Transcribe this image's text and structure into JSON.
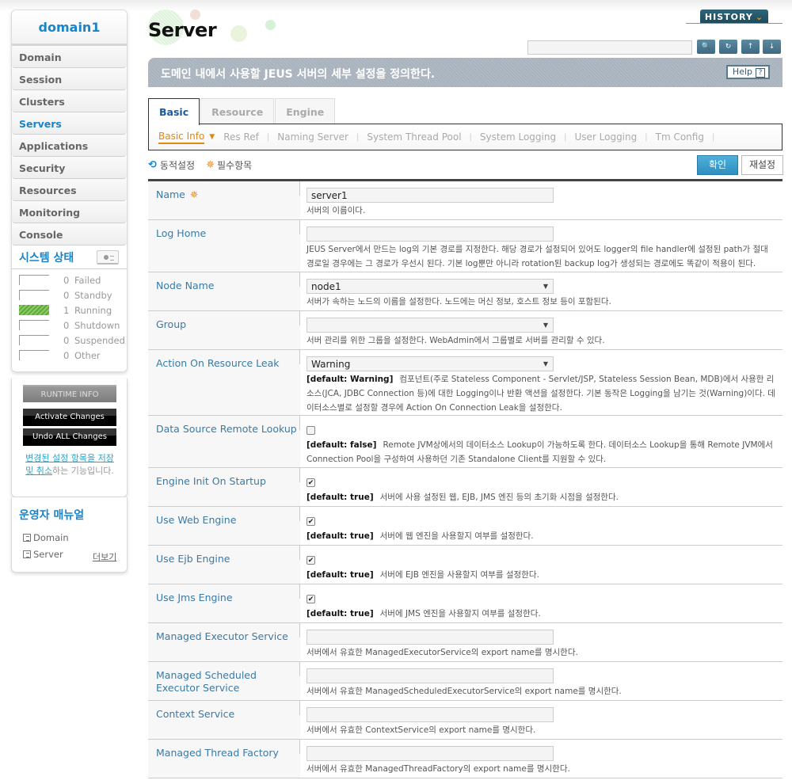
{
  "sidebar": {
    "domain": "domain1",
    "nav": [
      {
        "label": "Domain"
      },
      {
        "label": "Session"
      },
      {
        "label": "Clusters"
      },
      {
        "label": "Servers",
        "active": true
      },
      {
        "label": "Applications"
      },
      {
        "label": "Security"
      },
      {
        "label": "Resources"
      },
      {
        "label": "Monitoring"
      },
      {
        "label": "Console"
      }
    ],
    "system_status": {
      "title": "시스템 상태",
      "items": [
        {
          "count": "0",
          "label": "Failed"
        },
        {
          "count": "0",
          "label": "Standby"
        },
        {
          "count": "1",
          "label": "Running"
        },
        {
          "count": "0",
          "label": "Shutdown"
        },
        {
          "count": "0",
          "label": "Suspended"
        },
        {
          "count": "0",
          "label": "Other"
        }
      ]
    },
    "runtime_info": "RUNTIME INFO",
    "activate_changes": "Activate Changes",
    "undo_changes": "Undo ALL Changes",
    "note_link": "변경된 설정 항목을 저장 및 취소",
    "note_rest": "하는 기능입니다.",
    "manual": {
      "title": "운영자 매뉴얼",
      "items": [
        "Domain",
        "Server"
      ],
      "more": "더보기"
    }
  },
  "header": {
    "title": "Server",
    "history": "HISTORY",
    "search_value": "",
    "banner": "도메인 내에서 사용할 JEUS 서버의 세부 설정을 정의한다.",
    "help": "Help",
    "help_q": "?"
  },
  "tabs": [
    "Basic",
    "Resource",
    "Engine"
  ],
  "subnav": [
    "Basic Info",
    "Res Ref",
    "Naming Server",
    "System Thread Pool",
    "System Logging",
    "User Logging",
    "Tm Config"
  ],
  "legend": {
    "dynamic": "동적설정",
    "required": "필수항목"
  },
  "buttons": {
    "confirm": "확인",
    "reset": "재설정"
  },
  "form": [
    {
      "label": "Name",
      "type": "input",
      "value": "server1",
      "required": true,
      "desc": "서버의 이름이다."
    },
    {
      "label": "Log Home",
      "type": "input",
      "value": "",
      "desc": "JEUS Server에서 만드는 log의 기본 경로를 지정한다. 해당 경로가 설정되어 있어도 logger의 file handler에 설정된 path가 절대 경로일 경우에는 그 경로가 우선시 된다. 기본 log뿐만 아니라 rotation된 backup log가 생성되는 경로에도 똑같이 적용이 된다."
    },
    {
      "label": "Node Name",
      "type": "select",
      "value": "node1",
      "desc": "서버가 속하는 노드의 이름을 설정한다. 노드에는 머신 정보, 호스트 정보 등이 포함된다."
    },
    {
      "label": "Group",
      "type": "select",
      "value": "",
      "desc": "서버 관리를 위한 그룹을 설정한다. WebAdmin에서 그룹별로 서버를 관리할 수 있다."
    },
    {
      "label": "Action On Resource Leak",
      "type": "select",
      "value": "Warning",
      "default": "[default: Warning]",
      "desc": "컴포넌트(주로 Stateless Component - Servlet/JSP, Stateless Session Bean, MDB)에서 사용한 리소스(JCA, JDBC Connection 등)에 대한 Logging이나 반환 액션을 설정한다. 기본 동작은 Logging을 남기는 것(Warning)이다. 데이터소스별로 설정할 경우에 Action On Connection Leak을 설정한다."
    },
    {
      "label": "Data Source Remote Lookup",
      "type": "checkbox",
      "checked": false,
      "default": "[default: false]",
      "desc": "Remote JVM상에서의 데이터소스 Lookup이 가능하도록 한다. 데이터소스 Lookup을 통해 Remote JVM에서 Connection Pool을 구성하여 사용하던 기존 Standalone Client를 지원할 수 있다."
    },
    {
      "label": "Engine Init On Startup",
      "type": "checkbox",
      "checked": true,
      "default": "[default: true]",
      "desc": "서버에 사용 설정된 웹, EJB, JMS 엔진 등의 초기화 시점을 설정한다."
    },
    {
      "label": "Use Web Engine",
      "type": "checkbox",
      "checked": true,
      "default": "[default: true]",
      "desc": "서버에 웹 엔진을 사용할지 여부를 설정한다."
    },
    {
      "label": "Use Ejb Engine",
      "type": "checkbox",
      "checked": true,
      "default": "[default: true]",
      "desc": "서버에 EJB 엔진을 사용할지 여부를 설정한다."
    },
    {
      "label": "Use Jms Engine",
      "type": "checkbox",
      "checked": true,
      "default": "[default: true]",
      "desc": "서버에 JMS 엔진을 사용할지 여부를 설정한다."
    },
    {
      "label": "Managed Executor Service",
      "type": "input",
      "value": "",
      "desc": "서버에서 유효한 ManagedExecutorService의 export name를 명시한다."
    },
    {
      "label": "Managed Scheduled Executor Service",
      "type": "input",
      "value": "",
      "desc": "서버에서 유효한 ManagedScheduledExecutorService의 export name를 명시한다."
    },
    {
      "label": "Context Service",
      "type": "input",
      "value": "",
      "desc": "서버에서 유효한 ContextService의 export name를 명시한다."
    },
    {
      "label": "Managed Thread Factory",
      "type": "input",
      "value": "",
      "desc": "서버에서 유효한 ManagedThreadFactory의 export name를 명시한다."
    }
  ]
}
